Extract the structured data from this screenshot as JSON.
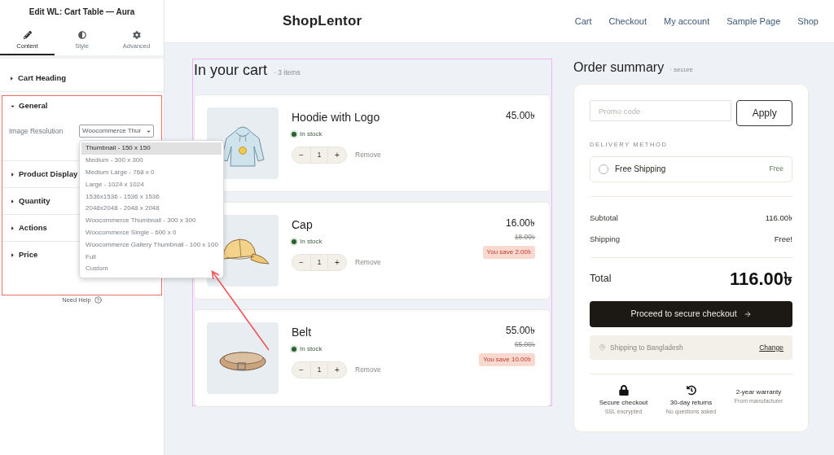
{
  "editor": {
    "title": "Edit WL: Cart Table — Aura",
    "tabs": [
      {
        "label": "Content",
        "selected": true
      },
      {
        "label": "Style",
        "selected": false
      },
      {
        "label": "Advanced",
        "selected": false
      }
    ],
    "sections": [
      {
        "label": "Cart Heading",
        "expanded": false
      },
      {
        "label": "General",
        "expanded": true,
        "field": {
          "label": "Image Resolution",
          "value": "Woocommerce Thur",
          "expanded": true,
          "options": [
            {
              "label": "Thumbnail - 150 x 150",
              "selected": true
            },
            {
              "label": "Medium - 300 x 300",
              "selected": false
            },
            {
              "label": "Medium Large - 768 x 0",
              "selected": false
            },
            {
              "label": "Large - 1024 x 1024",
              "selected": false
            },
            {
              "label": "1536x1536 - 1536 x 1536",
              "selected": false
            },
            {
              "label": "2048x2048 - 2048 x 2048",
              "selected": false
            },
            {
              "label": "Woocommerce Thumbnail - 300 x 300",
              "selected": false
            },
            {
              "label": "Woocommerce Single - 600 x 0",
              "selected": false
            },
            {
              "label": "Woocommerce Gallery Thumbnail - 100 x 100",
              "selected": false
            },
            {
              "label": "Full",
              "selected": false
            },
            {
              "label": "Custom",
              "selected": false
            }
          ]
        }
      },
      {
        "label": "Product Display",
        "expanded": false
      },
      {
        "label": "Quantity",
        "expanded": false
      },
      {
        "label": "Actions",
        "expanded": false
      },
      {
        "label": "Price",
        "expanded": false
      }
    ],
    "help": "Need Help"
  },
  "site": {
    "logo": "ShopLentor",
    "nav": [
      "Cart",
      "Checkout",
      "My account",
      "Sample Page",
      "Shop"
    ]
  },
  "cart": {
    "title": "In your cart",
    "count": "· 3 items",
    "items": [
      {
        "name": "Hoodie with Logo",
        "stock": "In stock",
        "decrement": "−",
        "quantity": "1",
        "increment": "+",
        "remove": "Remove",
        "price": "45.00৳"
      },
      {
        "name": "Cap",
        "stock": "In stock",
        "decrement": "−",
        "quantity": "1",
        "increment": "+",
        "remove": "Remove",
        "price": "16.00৳",
        "old_price": "18.00৳",
        "saving": "You save 2.00৳"
      },
      {
        "name": "Belt",
        "stock": "In stock",
        "decrement": "−",
        "quantity": "1",
        "increment": "+",
        "remove": "Remove",
        "price": "55.00৳",
        "old_price": "65.00৳",
        "saving": "You save 10.00৳"
      }
    ]
  },
  "summary": {
    "title": "Order summary",
    "note": "· secure",
    "promo": {
      "placeholder": "Promo code"
    },
    "apply": "Apply",
    "delivery_heading": "DELIVERY METHOD",
    "delivery_options": [
      {
        "label": "Free Shipping",
        "price": "Free",
        "selected": false
      }
    ],
    "rows": [
      {
        "label": "Subtotal",
        "value": "116.00৳"
      },
      {
        "label": "Shipping",
        "value": "Free!"
      }
    ],
    "total": {
      "label": "Total",
      "value": "116.00৳"
    },
    "checkout": "Proceed to secure checkout",
    "shipping_to": "Shipping to Bangladesh",
    "change": "Change",
    "features": [
      {
        "title": "Secure checkout",
        "subtitle": "SSL encrypted"
      },
      {
        "title": "30-day returns",
        "subtitle": "No questions asked"
      },
      {
        "title": "2-year warranty",
        "subtitle": "From manufacturer"
      }
    ]
  }
}
